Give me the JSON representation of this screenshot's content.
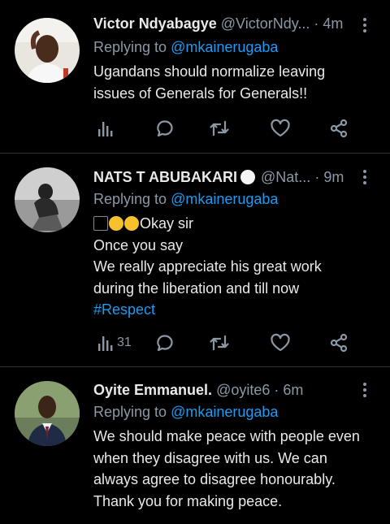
{
  "tweets": [
    {
      "name": "Victor Ndyabagye",
      "handle": "@VictorNdy...",
      "time": "· 4m",
      "replying_prefix": "Replying to",
      "replying_to": "@mkainerugaba",
      "lines": [
        "Ugandans should normalize leaving",
        "issues of Generals for Generals!!"
      ],
      "views": ""
    },
    {
      "name": "NATS T ABUBAKARI",
      "handle": "@Nat...",
      "time": "· 9m",
      "replying_prefix": "Replying to",
      "replying_to": "@mkainerugaba",
      "first_line_text": "Okay sir",
      "lines": [
        "Once you say",
        "We really appreciate his great work",
        "during the liberation and till now"
      ],
      "hashtag": "#Respect",
      "views": "31"
    },
    {
      "name": "Oyite Emmanuel.",
      "handle": "@oyite6",
      "time": "· 6m",
      "replying_prefix": "Replying to",
      "replying_to": "@mkainerugaba",
      "lines": [
        "We should make peace with people even",
        "when they disagree with us. We can",
        "always agree to disagree honourably.",
        "Thank you for making peace."
      ]
    }
  ],
  "icons": {
    "views": "views-icon",
    "reply": "reply-icon",
    "retweet": "retweet-icon",
    "like": "like-icon",
    "share": "share-icon",
    "more": "more-vertical-icon"
  },
  "colors": {
    "background": "#000000",
    "text": "#e7e9ea",
    "muted": "#8b98a5",
    "link": "#1d9bf0",
    "divider": "#2f3336"
  }
}
